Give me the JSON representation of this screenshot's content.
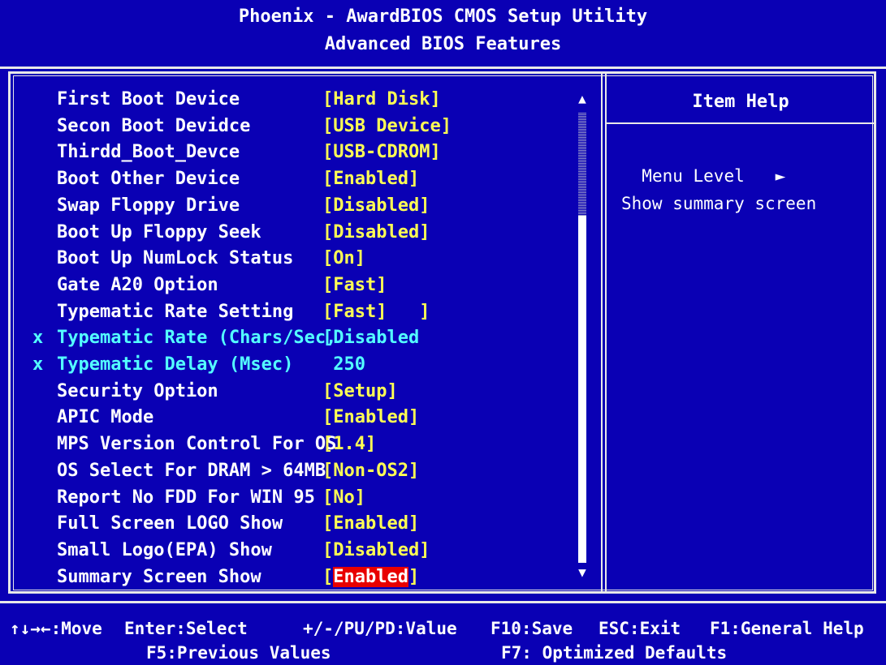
{
  "header": {
    "title": "Phoenix - AwardBIOS CMOS Setup Utility",
    "subtitle": "Advanced BIOS Features"
  },
  "menu": {
    "items": [
      {
        "label": "First Boot Device",
        "value": "[Hard Disk]",
        "disabled": false
      },
      {
        "label": "Secon Boot Devidce",
        "value": "[USB Device]",
        "disabled": false
      },
      {
        "label": "Thirdd_Boot_Devce",
        "value": "[USB-CDROM]",
        "disabled": false
      },
      {
        "label": "Boot Other Device",
        "value": "[Enabled]",
        "disabled": false
      },
      {
        "label": "Swap Floppy Drive",
        "value": "[Disabled]",
        "disabled": false
      },
      {
        "label": "Boot Up Floppy Seek",
        "value": "[Disabled]",
        "disabled": false
      },
      {
        "label": "Boot Up NumLock Status",
        "value": "[On]",
        "disabled": false
      },
      {
        "label": "Gate A20 Option",
        "value": "[Fast]",
        "disabled": false
      },
      {
        "label": "Typematic Rate Setting",
        "value": "[Fast]   ]",
        "disabled": false
      },
      {
        "label": "Typematic Rate (Chars/Sec,",
        "value": "[Disabled",
        "disabled": true,
        "marker": "x"
      },
      {
        "label": "Typematic Delay (Msec)",
        "value": " 250",
        "disabled": true,
        "marker": "x"
      },
      {
        "label": "Security Option",
        "value": "[Setup]",
        "disabled": false
      },
      {
        "label": "APIC Mode",
        "value": "[Enabled]",
        "disabled": false
      },
      {
        "label": "MPS Version Control For OS",
        "value": "[1.4]",
        "disabled": false
      },
      {
        "label": "OS Select For DRAM > 64MB",
        "value": "[Non-OS2]",
        "disabled": false
      },
      {
        "label": "Report No FDD For WIN 95",
        "value": "[No]",
        "disabled": false
      },
      {
        "label": "Full Screen LOGO Show",
        "value": "[Enabled]",
        "disabled": false
      },
      {
        "label": "Small Logo(EPA) Show",
        "value": "[Disabled]",
        "disabled": false
      },
      {
        "label": "Summary Screen Show",
        "value_prefix": "[",
        "value_hl": "Enabled",
        "value_suffix": "]",
        "disabled": false,
        "selected": true
      }
    ],
    "scroll_up_glyph": "▲",
    "scroll_down_glyph": "▼"
  },
  "help": {
    "title": "Item Help",
    "menu_level": "Menu Level",
    "menu_level_glyph": "►",
    "text": "Show summary screen"
  },
  "footer": {
    "move": "↑↓→←:Move",
    "enter": "Enter:Select",
    "value": "+/-/PU/PD:Value",
    "save": "F10:Save",
    "exit": "ESC:Exit",
    "general_help": "F1:General Help",
    "prev_values": "F5:Previous Values",
    "optimized": "F7: Optimized Defaults"
  },
  "colors": {
    "background": "#0a00b4",
    "value_text": "#ffff54",
    "disabled_text": "#54ffff",
    "highlight": "#e80000"
  }
}
